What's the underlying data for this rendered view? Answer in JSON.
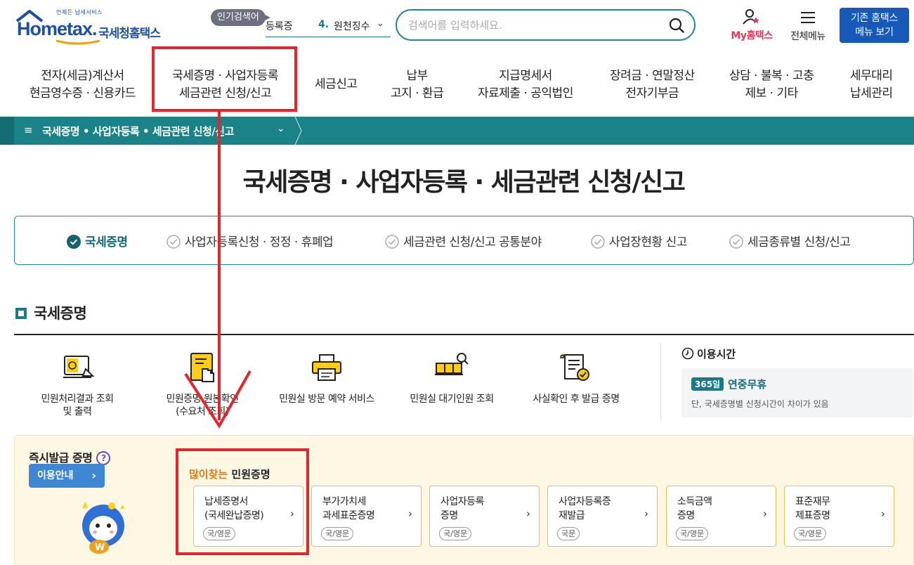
{
  "header": {
    "logo_small_text": "언제든 납세서비스",
    "logo_word": "Hometax.",
    "logo_name": "국세청홈택스",
    "popular_badge": "인기검색어",
    "ticker_prev": "등록증",
    "ticker_number": "4.",
    "ticker_item": "원천징수",
    "search_placeholder": "검색어를 입력하세요.",
    "my_hometax": "My홈택스",
    "all_menu": "전체메뉴",
    "old_menu_line1": "기존 홈택스",
    "old_menu_line2": "메뉴 보기"
  },
  "gnb": [
    {
      "line1": "전자(세금)계산서",
      "line2": "현금영수증 · 신용카드"
    },
    {
      "line1": "국세증명 · 사업자등록",
      "line2": "세금관련 신청/신고"
    },
    {
      "line1": "세금신고",
      "line2": ""
    },
    {
      "line1": "납부",
      "line2": "고지 · 환급"
    },
    {
      "line1": "지급명세서",
      "line2": "자료제출 · 공익법인"
    },
    {
      "line1": "장려금 · 연말정산",
      "line2": "전자기부금"
    },
    {
      "line1": "상담 · 불복 · 고충",
      "line2": "제보 · 기타"
    },
    {
      "line1": "세무대리",
      "line2": "납세관리"
    }
  ],
  "breadcrumb": "국세증명 • 사업자등록 • 세금관련 신청/신고",
  "page_title": "국세증명 · 사업자등록 · 세금관련 신청/신고",
  "tabs": [
    {
      "label": "국세증명",
      "active": true
    },
    {
      "label": "사업자등록신청 · 정정 · 휴폐업",
      "active": false
    },
    {
      "label": "세금관련 신청/신고 공통분야",
      "active": false
    },
    {
      "label": "사업장현황 신고",
      "active": false
    },
    {
      "label": "세금종류별 신청/신고",
      "active": false
    }
  ],
  "section_title": "국세증명",
  "services": [
    {
      "line1": "민원처리결과 조회",
      "line2": "및 출력",
      "icon": "document-screen-icon"
    },
    {
      "line1": "민원증명 원본확인",
      "line2": "(수요처 조회)",
      "icon": "document-hand-icon"
    },
    {
      "line1": "민원실 방문 예약 서비스",
      "line2": "",
      "icon": "printer-icon"
    },
    {
      "line1": "민원실 대기인원 조회",
      "line2": "",
      "icon": "waiting-seats-icon"
    },
    {
      "line1": "사실확인 후 발급 증명",
      "line2": "",
      "icon": "certificate-check-icon"
    }
  ],
  "hours": {
    "title": "이용시간",
    "badge": "365일",
    "main": "연중무휴",
    "note": "단, 국세증명별 신청시간이 차이가 있음"
  },
  "instant": {
    "title": "즉시발급 증명",
    "help": "?",
    "guide_button": "이용안내",
    "popular_accent": "많이찾는",
    "popular_rest": " 민원증명"
  },
  "cards": [
    {
      "line1": "납세증명서",
      "line2": "(국세완납증명)",
      "tag": "국/영문"
    },
    {
      "line1": "부가가치세",
      "line2": "과세표준증명",
      "tag": "국/영문"
    },
    {
      "line1": "사업자등록",
      "line2": "증명",
      "tag": "국/영문"
    },
    {
      "line1": "사업자등록증",
      "line2": "재발급",
      "tag": "국문"
    },
    {
      "line1": "소득금액",
      "line2": "증명",
      "tag": "국/영문"
    },
    {
      "line1": "표준재무",
      "line2": "제표증명",
      "tag": "국/영문"
    }
  ],
  "colors": {
    "brand_blue": "#1d4fa3",
    "teal": "#1b8288",
    "annotation_red": "#e3262c",
    "accent_orange": "#e07a12"
  }
}
